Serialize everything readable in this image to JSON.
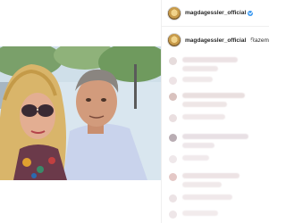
{
  "post": {
    "author": "magdagessler_official",
    "caption_prefix": "magdagessler_official",
    "caption_text": "Razem",
    "caption_emoji": "❤",
    "verified_icon": "verified-badge-icon",
    "colors": {
      "verified": "#3897f0",
      "heart": "#e0245e"
    }
  }
}
